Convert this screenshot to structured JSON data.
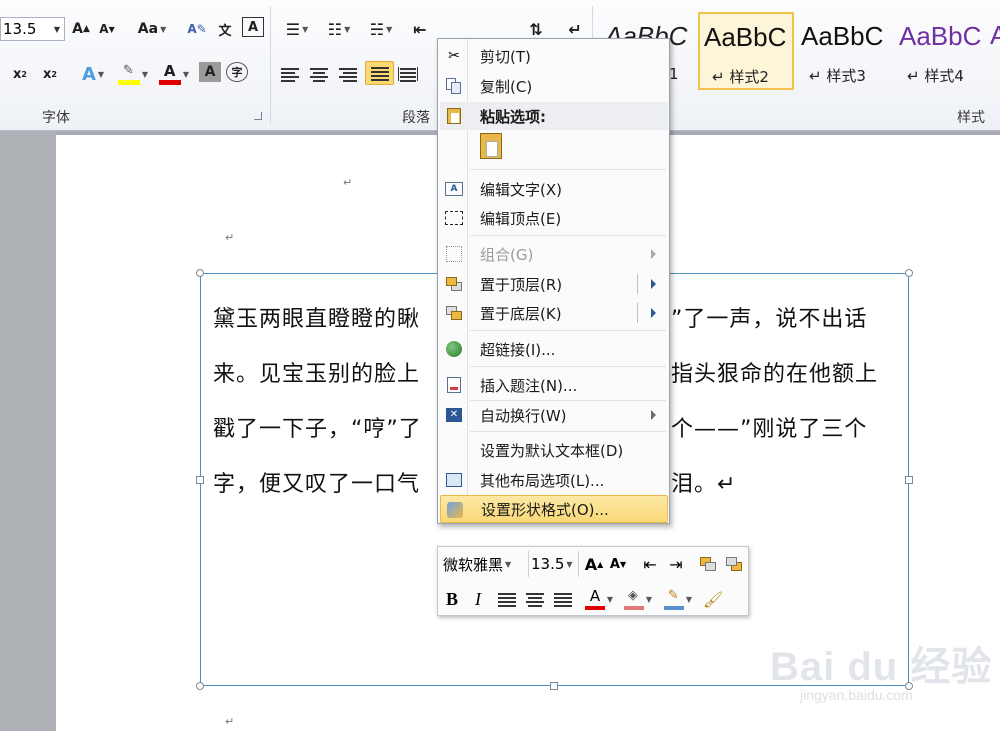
{
  "ribbon": {
    "font_size_value": "13.5",
    "group_font_label": "字体",
    "group_paragraph_label": "段落",
    "group_styles_label": "样式",
    "styles": [
      {
        "sample": "AaBbC",
        "name": "1",
        "color": "#111111"
      },
      {
        "sample": "AaBbC",
        "name": "↵ 样式2",
        "color": "#111111"
      },
      {
        "sample": "AaBbC",
        "name": "↵ 样式3",
        "color": "#111111"
      },
      {
        "sample": "AaBbC",
        "name": "↵ 样式4",
        "color": "#7030a0"
      }
    ],
    "extra_style_glyph": "A"
  },
  "document": {
    "paragraph_mark": "↵",
    "textbox_lines": [
      "黛玉两眼直瞪瞪的瞅",
      "来。见宝玉别的脸上",
      "戳了一下子，“哼”了",
      "字，便又叹了一口气"
    ],
    "textbox_lines_right": [
      "”了一声，说不出话",
      "指头狠命的在他额上",
      "个——”刚说了三个",
      "泪。↵"
    ]
  },
  "context_menu": {
    "items": [
      {
        "label": "剪切(T)",
        "icon": "scissors-icon"
      },
      {
        "label": "复制(C)",
        "icon": "copy-icon"
      },
      {
        "label": "粘贴选项:",
        "icon": "paste-icon"
      },
      {
        "label": "编辑文字(X)",
        "icon": "edit-text-icon"
      },
      {
        "label": "编辑顶点(E)",
        "icon": "edit-points-icon"
      },
      {
        "label": "组合(G)",
        "icon": "group-icon"
      },
      {
        "label": "置于顶层(R)",
        "icon": "bring-front-icon"
      },
      {
        "label": "置于底层(K)",
        "icon": "send-back-icon"
      },
      {
        "label": "超链接(I)...",
        "icon": "hyperlink-icon"
      },
      {
        "label": "插入题注(N)...",
        "icon": "caption-icon"
      },
      {
        "label": "自动换行(W)",
        "icon": "wrap-text-icon"
      },
      {
        "label": "设置为默认文本框(D)",
        "icon": ""
      },
      {
        "label": "其他布局选项(L)...",
        "icon": "layout-options-icon"
      },
      {
        "label": "设置形状格式(O)...",
        "icon": "format-shape-icon"
      }
    ]
  },
  "mini_toolbar": {
    "font_name": "微软雅黑",
    "font_size": "13.5"
  },
  "watermark": {
    "big": "Bai du 经验",
    "small": "jingyan.baidu.com"
  },
  "colors": {
    "highlight_yellow": "#ffff00",
    "font_red": "#e00000",
    "menu_active": "#f9d877",
    "textbox_border": "#4b8fc2"
  }
}
